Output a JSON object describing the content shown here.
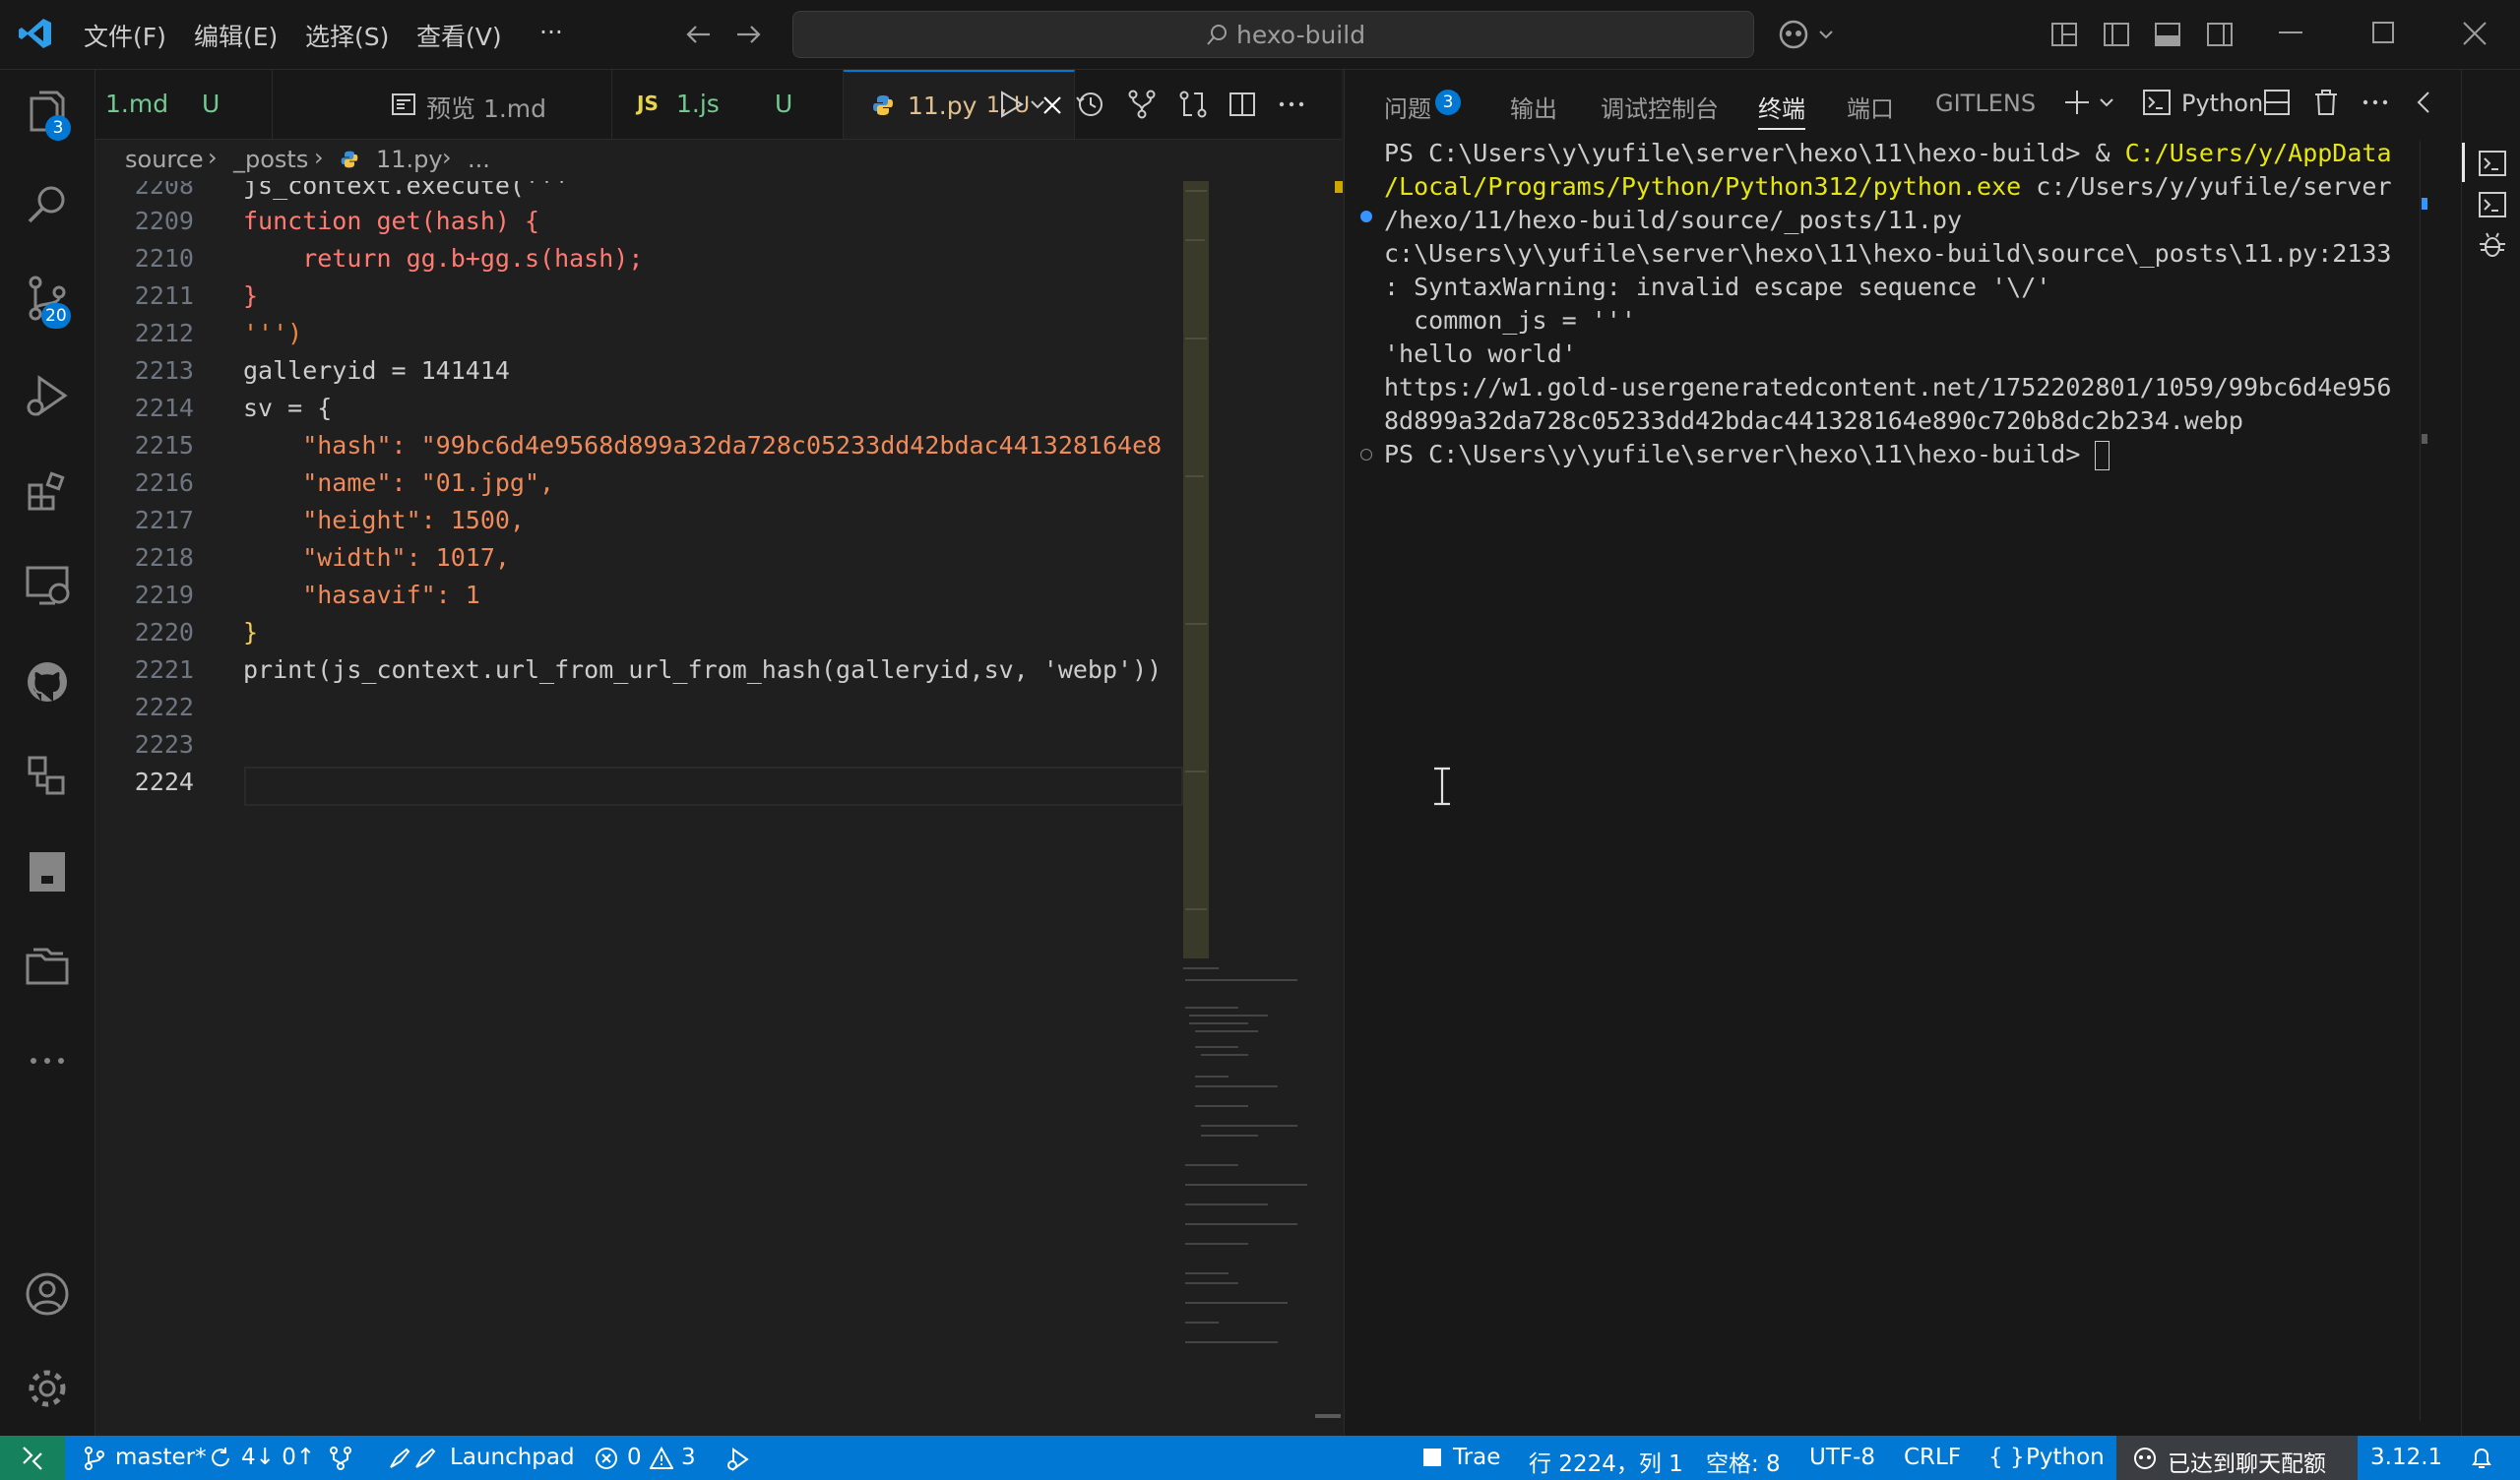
{
  "titlebar": {
    "menus": [
      "文件(F)",
      "编辑(E)",
      "选择(S)",
      "查看(V)",
      "···"
    ],
    "search_text": "hexo-build"
  },
  "activity": {
    "explorer_badge": "3",
    "scm_badge": "20"
  },
  "tabs": [
    {
      "label": "1.md",
      "status": "U"
    },
    {
      "label": "预览 1.md",
      "status": ""
    },
    {
      "label": "1.js",
      "status": "U",
      "prefix": "JS"
    },
    {
      "label": "11.py",
      "status": "1, U"
    }
  ],
  "breadcrumb": [
    "source",
    "_posts",
    "11.py",
    "..."
  ],
  "code_lines": [
    {
      "num": "2208",
      "text": "js_context.execute('''"
    },
    {
      "num": "2209",
      "text": "function get(hash) {"
    },
    {
      "num": "2210",
      "text": "    return gg.b+gg.s(hash);"
    },
    {
      "num": "2211",
      "text": "}"
    },
    {
      "num": "2212",
      "text": "''')"
    },
    {
      "num": "2213",
      "text": "galleryid = 141414"
    },
    {
      "num": "2214",
      "text": "sv = {"
    },
    {
      "num": "2215",
      "text": "    \"hash\": \"99bc6d4e9568d899a32da728c05233dd42bdac441328164e8"
    },
    {
      "num": "2216",
      "text": "    \"name\": \"01.jpg\","
    },
    {
      "num": "2217",
      "text": "    \"height\": 1500,"
    },
    {
      "num": "2218",
      "text": "    \"width\": 1017,"
    },
    {
      "num": "2219",
      "text": "    \"hasavif\": 1"
    },
    {
      "num": "2220",
      "text": "}"
    },
    {
      "num": "2221",
      "text": "print(js_context.url_from_url_from_hash(galleryid,sv, 'webp'))"
    },
    {
      "num": "2222",
      "text": ""
    },
    {
      "num": "2223",
      "text": ""
    },
    {
      "num": "2224",
      "text": ""
    }
  ],
  "panel": {
    "tabs": [
      "问题",
      "输出",
      "调试控制台",
      "终端",
      "端口",
      "GITLENS"
    ],
    "problems_count": "3",
    "active_tab": "终端",
    "terminal_name": "Python"
  },
  "terminal_lines": [
    {
      "plain": "PS C:\\Users\\y\\yufile\\server\\hexo\\11\\hexo-build> & ",
      "hl": "C:/Users/y/AppData"
    },
    {
      "plain": "",
      "hl": "/Local/Programs/Python/Python312/python.exe",
      "tail": " c:/Users/y/yufile/server"
    },
    {
      "plain": "/hexo/11/hexo-build/source/_posts/11.py"
    },
    {
      "plain": "c:\\Users\\y\\yufile\\server\\hexo\\11\\hexo-build\\source\\_posts\\11.py:2133"
    },
    {
      "plain": ": SyntaxWarning: invalid escape sequence '\\/'"
    },
    {
      "plain": "  common_js = '''"
    },
    {
      "plain": "'hello world'"
    },
    {
      "plain": "https://w1.gold-usergeneratedcontent.net/1752202801/1059/99bc6d4e956"
    },
    {
      "plain": "8d899a32da728c05233dd42bdac441328164e890c720b8dc2b234.webp"
    },
    {
      "plain": "PS C:\\Users\\y\\yufile\\server\\hexo\\11\\hexo-build> "
    }
  ],
  "statusbar": {
    "branch": "master*",
    "sync": "4↓ 0↑",
    "launchpad": "Launchpad",
    "errors": "0",
    "warnings": "3",
    "trae": "Trae",
    "position": "行 2224，列 1",
    "spaces": "空格: 8",
    "encoding": "UTF-8",
    "eol": "CRLF",
    "language": "Python",
    "chat": "已达到聊天配额",
    "version": "3.12.1"
  },
  "colors": {
    "accent": "#0078d4",
    "terminal_highlight": "#e5e510"
  }
}
